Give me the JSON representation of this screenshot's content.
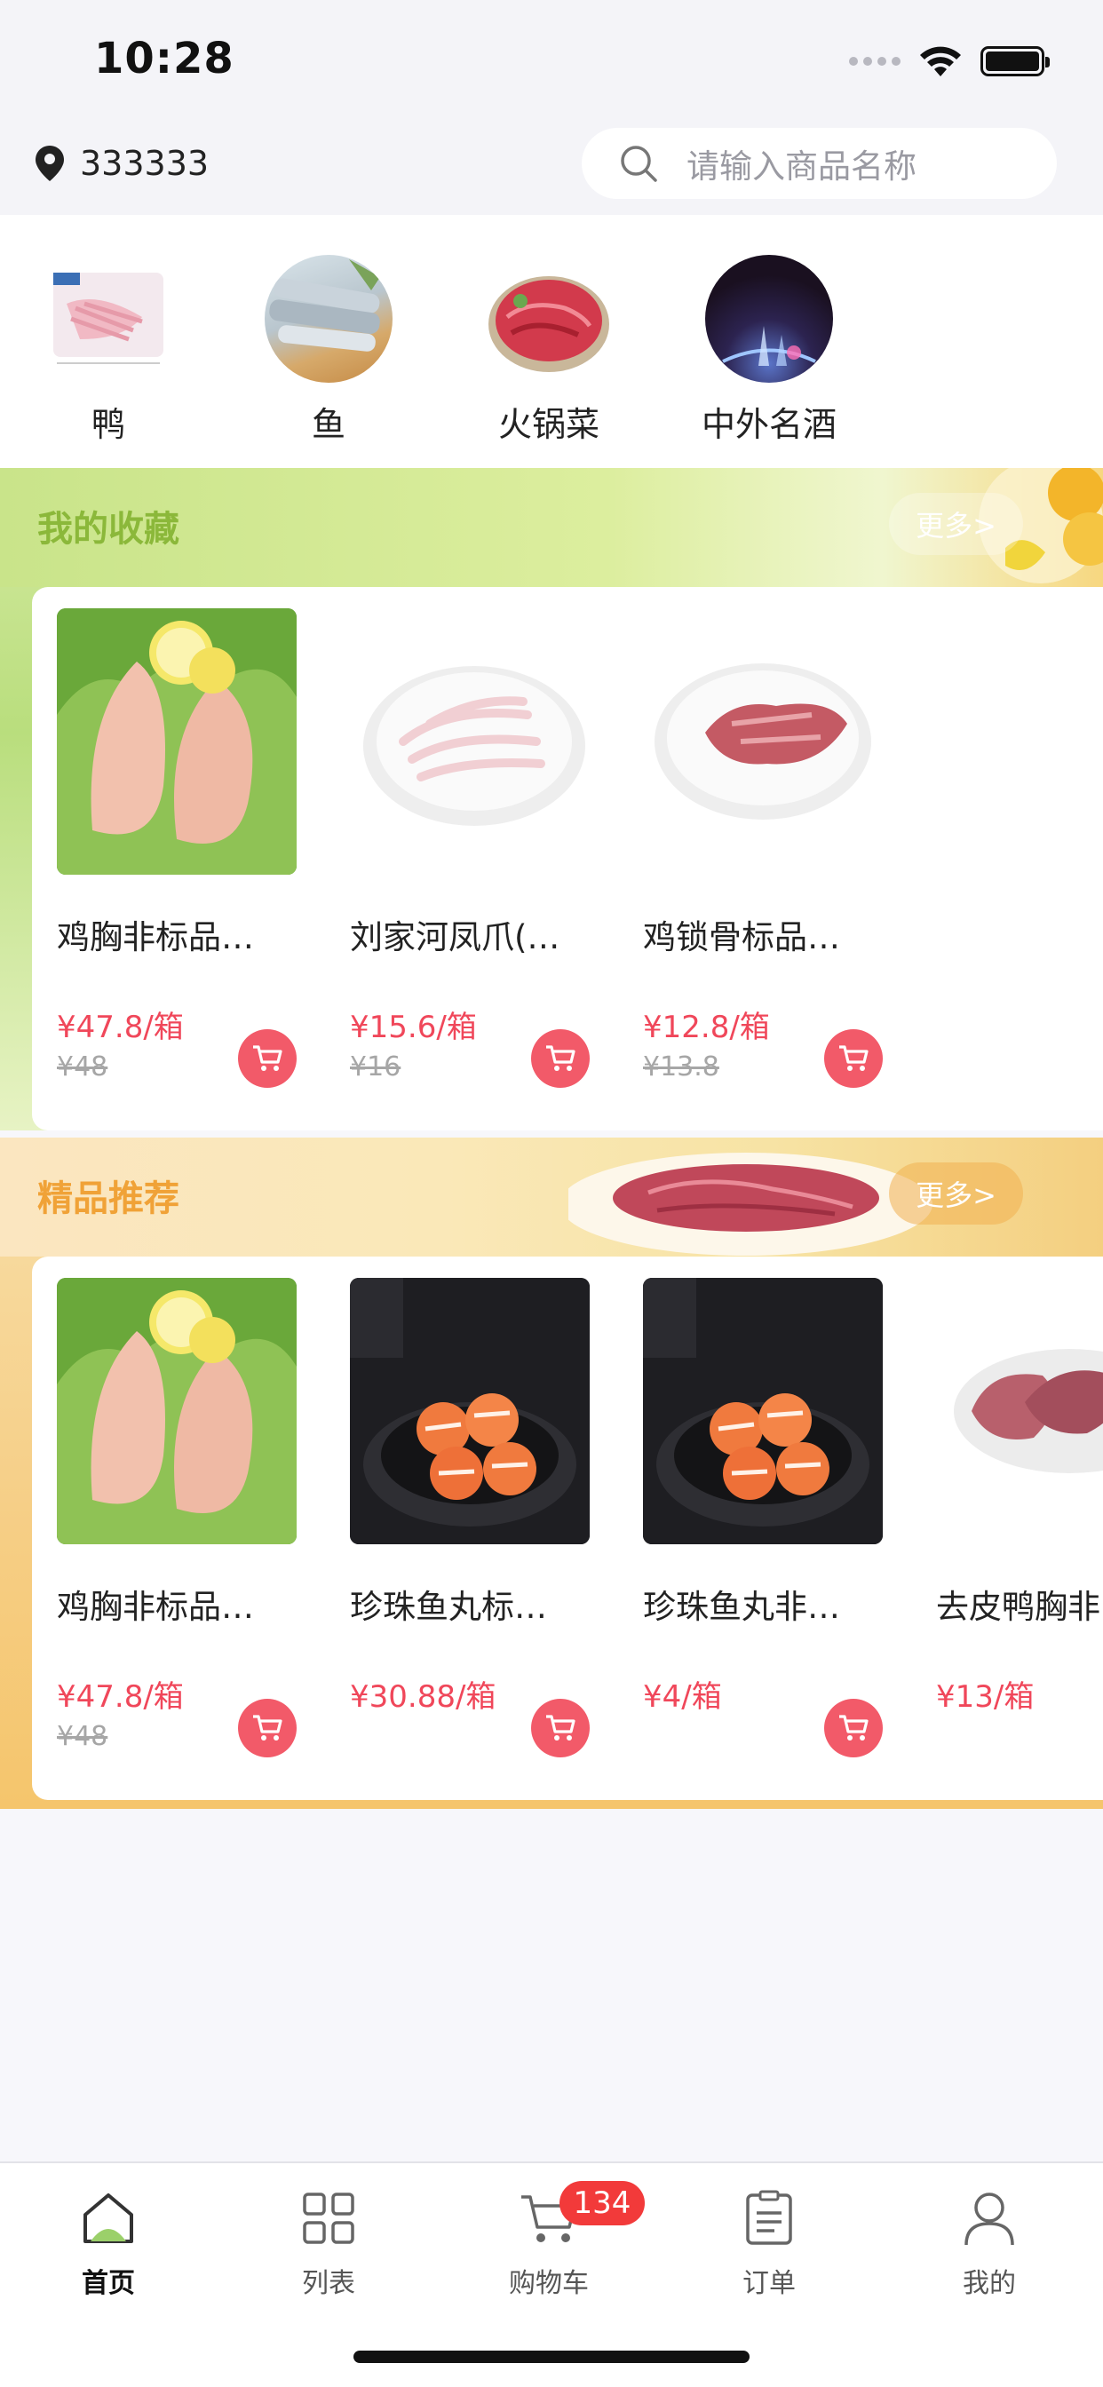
{
  "status": {
    "time": "10:28"
  },
  "header": {
    "location": "333333",
    "search_placeholder": "请输入商品名称"
  },
  "categories": [
    {
      "label": "鸭",
      "icon": "duck-feet-image"
    },
    {
      "label": "鱼",
      "icon": "fish-image"
    },
    {
      "label": "火锅菜",
      "icon": "hotpot-meat-image"
    },
    {
      "label": "中外名酒",
      "icon": "fountain-night-image"
    }
  ],
  "favorites": {
    "title": "我的收藏",
    "more": "更多>",
    "products": [
      {
        "name": "鸡胸非标品…",
        "price": "¥47.8/箱",
        "old_price": "¥48"
      },
      {
        "name": "刘家河凤爪(…",
        "price": "¥15.6/箱",
        "old_price": "¥16"
      },
      {
        "name": "鸡锁骨标品…",
        "price": "¥12.8/箱",
        "old_price": "¥13.8"
      }
    ]
  },
  "recommend": {
    "title": "精品推荐",
    "more": "更多>",
    "products": [
      {
        "name": "鸡胸非标品…",
        "price": "¥47.8/箱",
        "old_price": "¥48"
      },
      {
        "name": "珍珠鱼丸标…",
        "price": "¥30.88/箱",
        "old_price": ""
      },
      {
        "name": "珍珠鱼丸非…",
        "price": "¥4/箱",
        "old_price": ""
      },
      {
        "name": "去皮鸭胸非",
        "price": "¥13/箱",
        "old_price": ""
      }
    ]
  },
  "tabbar": {
    "home": "首页",
    "list": "列表",
    "cart": "购物车",
    "cart_badge": "134",
    "orders": "订单",
    "mine": "我的"
  },
  "colors": {
    "price": "#f0475a",
    "cart_button": "#f25a69",
    "favorites_title": "#8bb83a",
    "recommend_title": "#f0a237",
    "badge": "#f23a3a"
  }
}
